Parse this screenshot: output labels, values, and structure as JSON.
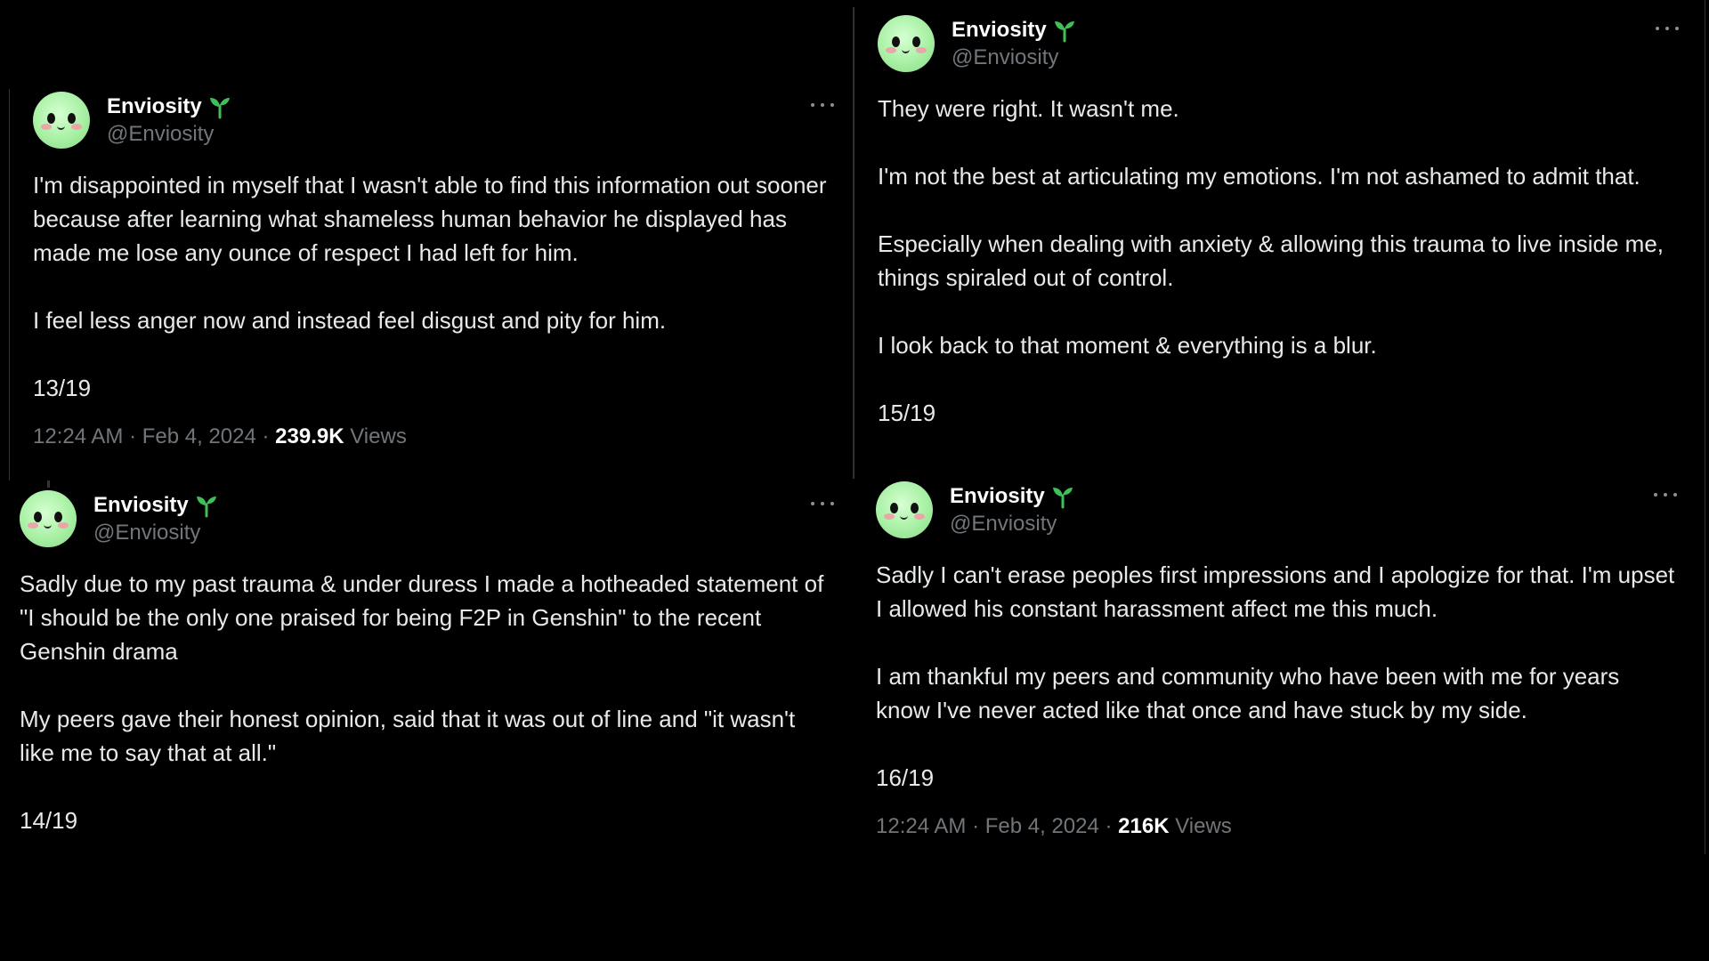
{
  "colors": {
    "background": "#000000",
    "text": "#e7e9ea",
    "muted": "#71767b",
    "sprout": "#3fbf5a",
    "avatar": "#a8f0a4"
  },
  "tweets": [
    {
      "name": "Enviosity",
      "badge_icon": "sprout-icon",
      "handle": "@Enviosity",
      "paragraphs": [
        "I'm disappointed in myself that I wasn't able to find this information out sooner because after learning what shameless human behavior he displayed has made me lose any ounce of respect I had left for him.",
        "I feel less anger now and instead feel disgust and pity for him."
      ],
      "count": "13/19",
      "time": "12:24 AM",
      "date": "Feb 4, 2024",
      "views_count": "239.9K",
      "views_label": "Views"
    },
    {
      "name": "Enviosity",
      "badge_icon": "sprout-icon",
      "handle": "@Enviosity",
      "paragraphs": [
        "They were right. It wasn't me.",
        "I'm not the best at articulating my emotions. I'm not ashamed to admit that.",
        "Especially when dealing with anxiety & allowing this trauma to live inside me, things spiraled out of control.",
        "I look back to that moment & everything is a blur."
      ],
      "count": "15/19"
    },
    {
      "name": "Enviosity",
      "badge_icon": "sprout-icon",
      "handle": "@Enviosity",
      "paragraphs": [
        "Sadly due to my past trauma & under duress I made a hotheaded statement of \"I should be the only one praised for being F2P in Genshin\" to the recent Genshin drama",
        "My peers gave their honest opinion, said that it was out of line and \"it wasn't like me to say that at all.\""
      ],
      "count": "14/19"
    },
    {
      "name": "Enviosity",
      "badge_icon": "sprout-icon",
      "handle": "@Enviosity",
      "paragraphs": [
        "Sadly I can't erase peoples first impressions and I apologize for that. I'm upset I allowed his constant harassment affect me this much.",
        "I am thankful my peers and community who have been with me for years know I've never acted like that once and have stuck by my side."
      ],
      "count": "16/19",
      "time": "12:24 AM",
      "date": "Feb 4, 2024",
      "views_count": "216K",
      "views_label": "Views"
    }
  ]
}
